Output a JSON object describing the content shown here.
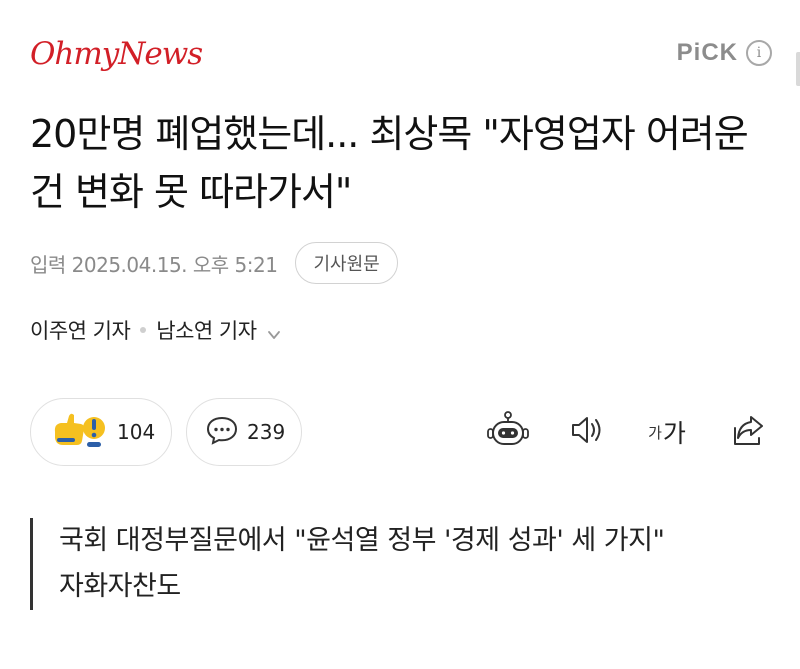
{
  "header": {
    "logo": "OhmyNews",
    "pick_label": "PiCK",
    "info_symbol": "i"
  },
  "article": {
    "title": "20만명 폐업했는데... 최상목 \"자영업자 어려운 건 변화 못 따라가서\"",
    "date": "입력 2025.04.15. 오후 5:21",
    "original_button": "기사원문",
    "reporters": [
      "이주연 기자",
      "남소연 기자"
    ],
    "subtitle": "국회 대정부질문에서 \"윤석열 정부 '경제 성과' 세 가지\" 자화자찬도"
  },
  "actions": {
    "reaction_count": "104",
    "comment_count": "239",
    "font_small": "가",
    "font_big": "가"
  },
  "icons": {
    "reaction": "reaction-emoji-icon",
    "comment": "comment-bubble-icon",
    "summary_bot": "robot-summary-icon",
    "speaker": "speaker-icon",
    "font_size": "font-size-icon",
    "share": "share-icon",
    "reporters_expand": "chevron-down-icon"
  },
  "colors": {
    "brand": "#d21f27",
    "text": "#111111",
    "muted": "#8a8a8a",
    "reaction_yellow": "#f5c020",
    "reaction_blue": "#2c5fa8"
  }
}
